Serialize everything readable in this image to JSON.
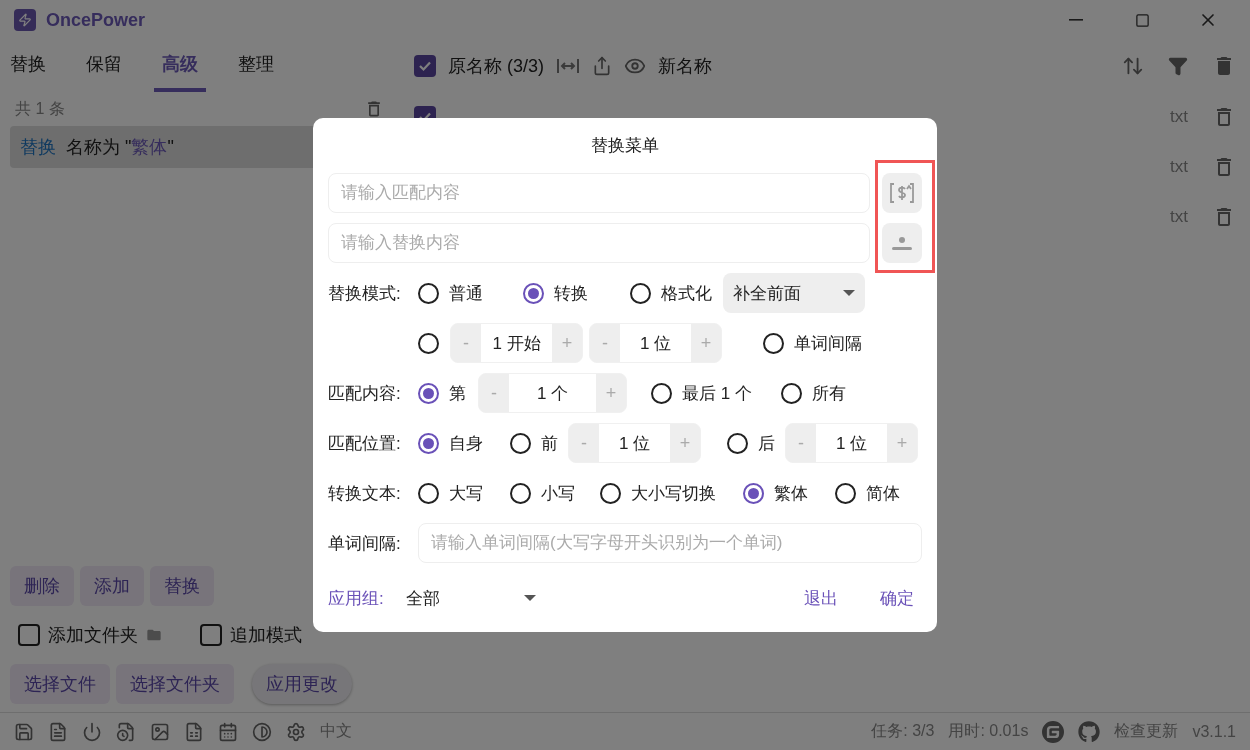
{
  "window": {
    "title": "OncePower"
  },
  "tabs": [
    {
      "label": "替换",
      "selected": false
    },
    {
      "label": "保留",
      "selected": false
    },
    {
      "label": "高级",
      "selected": true
    },
    {
      "label": "整理",
      "selected": false
    }
  ],
  "rules": {
    "count": "共 1 条",
    "items": [
      {
        "action": "替换",
        "prefix": "名称为 \"",
        "value": "繁体",
        "suffix": "\"",
        "selected": true
      }
    ]
  },
  "rule_buttons": [
    "删除",
    "添加",
    "替换"
  ],
  "options": [
    {
      "label": "添加文件夹",
      "checked": false,
      "kind": "folder"
    },
    {
      "label": "追加模式",
      "checked": false,
      "kind": "plain"
    }
  ],
  "file_buttons": [
    "选择文件",
    "选择文件夹"
  ],
  "apply_button": "应用更改",
  "file_header": {
    "checked": true,
    "original_label": "原名称 (3/3)",
    "new_label": "新名称"
  },
  "files": [
    {
      "checked": true,
      "ext": "txt"
    },
    {
      "ext": "txt"
    },
    {
      "ext": "txt"
    }
  ],
  "status_bar": {
    "language": "中文",
    "tasks": "任务: 3/3",
    "time": "用时: 0.01s",
    "update": "检查更新",
    "version": "v3.1.1"
  },
  "dialog": {
    "title": "替换菜单",
    "match_placeholder": "请输入匹配内容",
    "replace_placeholder": "请输入替换内容",
    "mode": {
      "label": "替换模式:",
      "options": [
        {
          "label": "普通",
          "selected": false
        },
        {
          "label": "转换",
          "selected": true
        },
        {
          "label": "格式化",
          "selected": false
        }
      ],
      "select": "补全前面"
    },
    "format": {
      "selected": false,
      "start": {
        "minus": "-",
        "value": "1 开始",
        "plus": "+"
      },
      "digits": {
        "minus": "-",
        "value": "1 位",
        "plus": "+"
      },
      "word_option": {
        "label": "单词间隔",
        "selected": false
      }
    },
    "match_content": {
      "label": "匹配内容:",
      "nth": {
        "label": "第",
        "selected": true,
        "stepper": {
          "minus": "-",
          "value": "1 个",
          "plus": "+"
        }
      },
      "options": [
        {
          "label": "最后 1 个",
          "selected": false
        },
        {
          "label": "所有",
          "selected": false
        }
      ]
    },
    "match_position": {
      "label": "匹配位置:",
      "self": {
        "label": "自身",
        "selected": true
      },
      "before": {
        "label": "前",
        "selected": false,
        "stepper": {
          "minus": "-",
          "value": "1 位",
          "plus": "+"
        }
      },
      "after": {
        "label": "后",
        "selected": false,
        "stepper": {
          "minus": "-",
          "value": "1 位",
          "plus": "+"
        }
      }
    },
    "convert": {
      "label": "转换文本:",
      "options": [
        {
          "label": "大写",
          "selected": false
        },
        {
          "label": "小写",
          "selected": false
        },
        {
          "label": "大小写切换",
          "selected": false
        },
        {
          "label": "繁体",
          "selected": true
        },
        {
          "label": "简体",
          "selected": false
        }
      ]
    },
    "word_separator": {
      "label": "单词间隔:",
      "placeholder": "请输入单词间隔(大写字母开头识别为一个单词)"
    },
    "group": {
      "label": "应用组:",
      "value": "全部"
    },
    "cancel": "退出",
    "confirm": "确定"
  }
}
